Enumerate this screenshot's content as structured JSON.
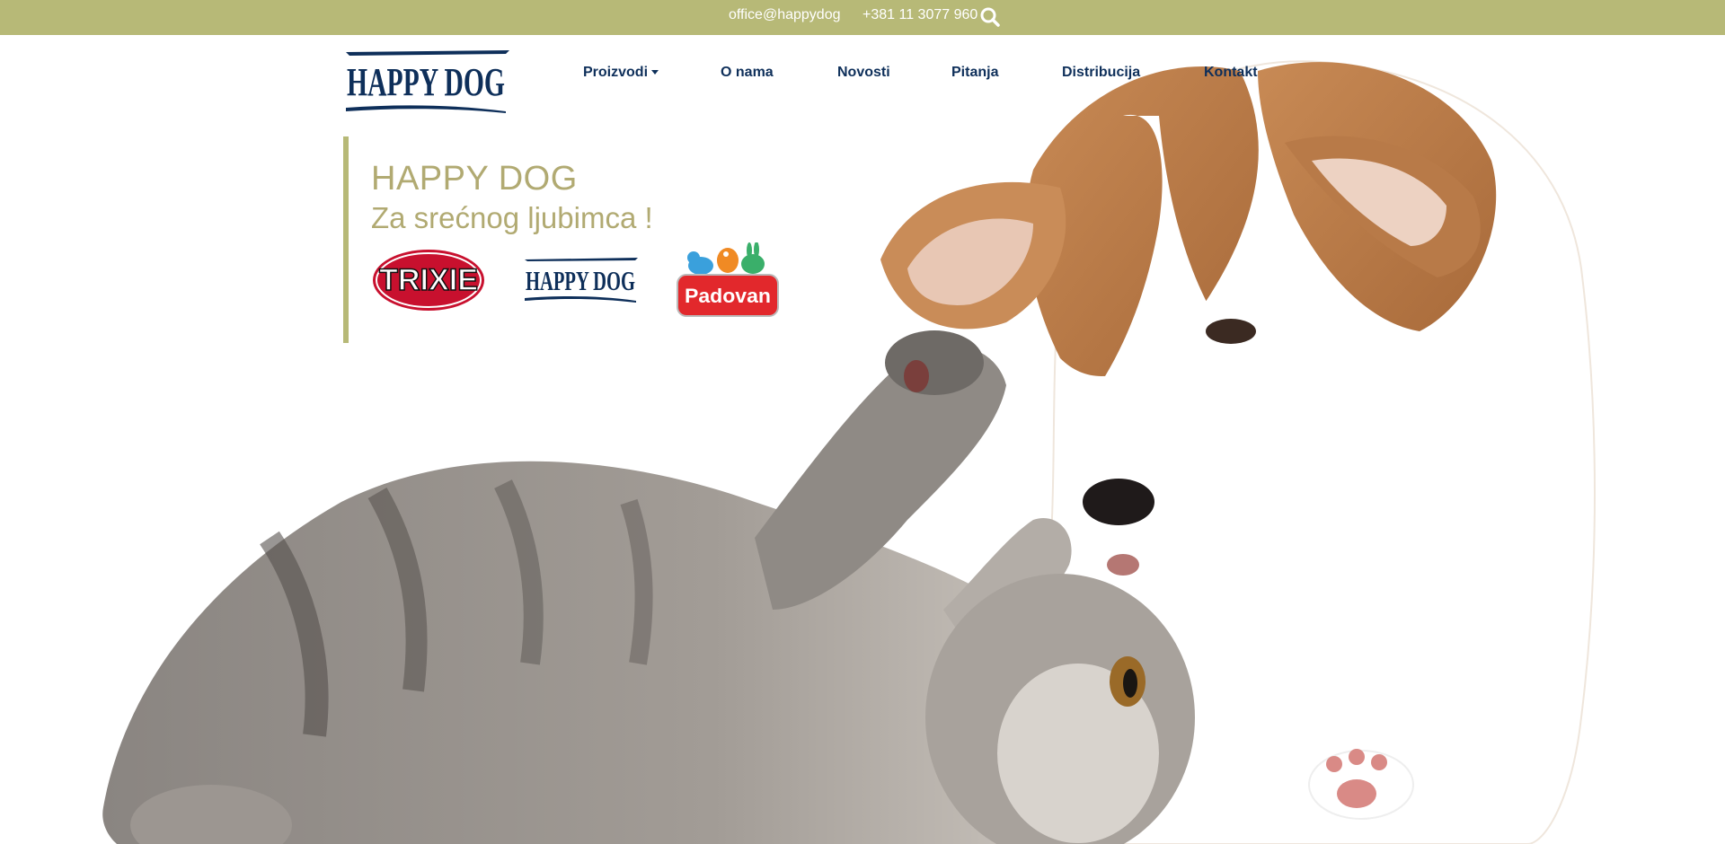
{
  "topbar": {
    "email": "office@happydog",
    "phone": "+381 11 3077 960",
    "search_icon": "search-icon"
  },
  "header": {
    "logo_text": "HAPPY DOG"
  },
  "nav": {
    "items": [
      {
        "label": "Proizvodi",
        "has_dropdown": true
      },
      {
        "label": "O nama"
      },
      {
        "label": "Novosti"
      },
      {
        "label": "Pitanja"
      },
      {
        "label": "Distribucija"
      },
      {
        "label": "Kontakt"
      }
    ]
  },
  "hero": {
    "title": "HAPPY DOG",
    "subtitle": "Za srećnog ljubimca !",
    "brands": [
      {
        "name": "TRIXIE"
      },
      {
        "name": "HAPPY DOG"
      },
      {
        "name": "Padovan"
      }
    ],
    "image": "puppy-and-kitten-photo"
  },
  "colors": {
    "accent": "#b7b977",
    "title": "#b1aa72",
    "nav": "#0e2f5a",
    "trixie_red": "#c8102e",
    "padovan_red": "#e2282c"
  }
}
